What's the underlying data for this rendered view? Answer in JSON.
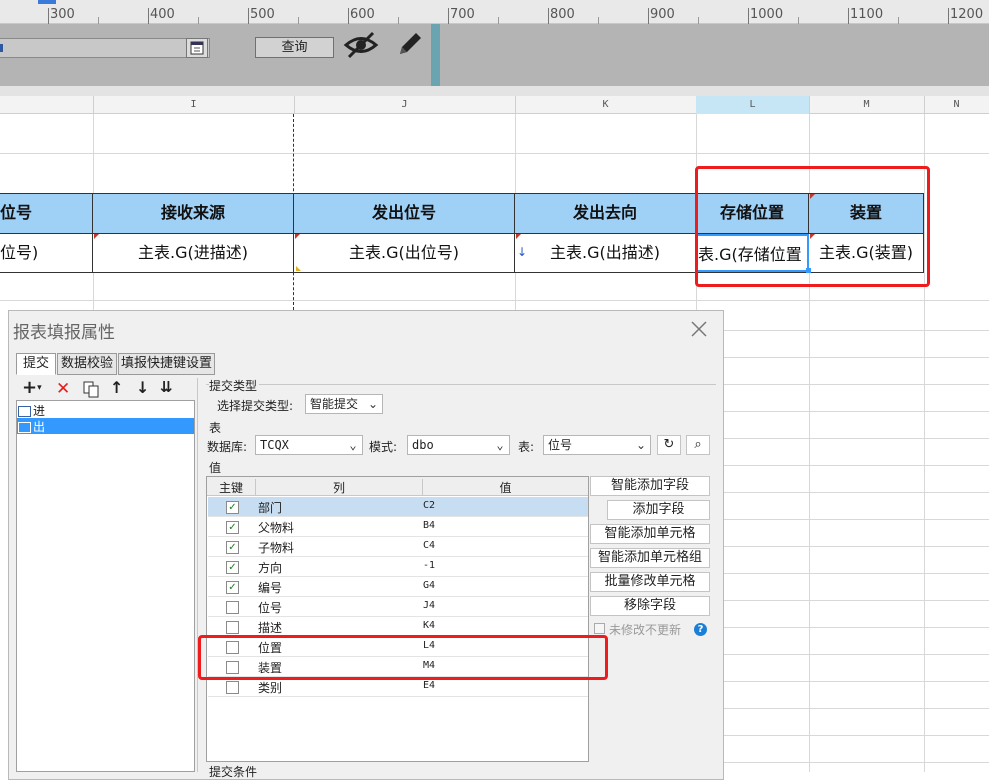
{
  "ruler": {
    "labels": [
      "300",
      "400",
      "500",
      "600",
      "700",
      "800",
      "900",
      "1000",
      "1100",
      "1200"
    ]
  },
  "param": {
    "query_label": "查询"
  },
  "columns": [
    "I",
    "J",
    "K",
    "L",
    "M",
    "N"
  ],
  "sheet": {
    "headers": [
      "位号",
      "接收来源",
      "发出位号",
      "发出去向",
      "存储位置",
      "装置"
    ],
    "values": [
      "位号)",
      "主表.G(进描述)",
      "主表.G(出位号)",
      "主表.G(出描述)",
      "表.G(存储位置",
      "主表.G(装置)"
    ]
  },
  "dialog": {
    "title": "报表填报属性",
    "tabs": [
      "提交",
      "数据校验",
      "填报快捷键设置"
    ],
    "tree": [
      "进",
      "出"
    ],
    "section_submit_type": "提交类型",
    "choose_type_label": "选择提交类型:",
    "submit_type_value": "智能提交",
    "section_table": "表",
    "db_label": "数据库:",
    "db_value": "TCQX",
    "schema_label": "模式:",
    "schema_value": "dbo",
    "table_label": "表:",
    "table_value": "位号",
    "section_value": "值",
    "grid_headers": {
      "key": "主键",
      "col": "列",
      "val": "值"
    },
    "rows": [
      {
        "name": "部门",
        "value": "C2",
        "checked": true
      },
      {
        "name": "父物料",
        "value": "B4",
        "checked": true
      },
      {
        "name": "子物料",
        "value": "C4",
        "checked": true
      },
      {
        "name": "方向",
        "value": "-1",
        "checked": true
      },
      {
        "name": "编号",
        "value": "G4",
        "checked": true
      },
      {
        "name": "位号",
        "value": "J4",
        "checked": false
      },
      {
        "name": "描述",
        "value": "K4",
        "checked": false
      },
      {
        "name": "位置",
        "value": "L4",
        "checked": false
      },
      {
        "name": "装置",
        "value": "M4",
        "checked": false
      },
      {
        "name": "类别",
        "value": "E4",
        "checked": false
      }
    ],
    "buttons": [
      "智能添加字段",
      "添加字段",
      "智能添加单元格",
      "智能添加单元格组",
      "批量修改单元格",
      "移除字段"
    ],
    "no_update_label": "未修改不更新",
    "bottom_section": "提交条件"
  },
  "colors": {
    "header_fill": "#9fd0f6",
    "highlight": "#ee1c1c",
    "selected": "#3399ff"
  }
}
